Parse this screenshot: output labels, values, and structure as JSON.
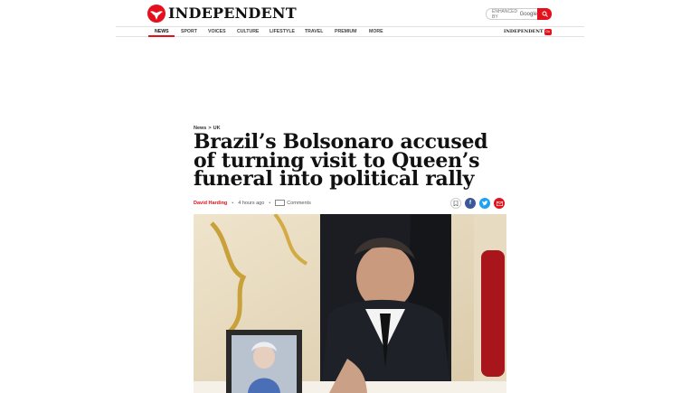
{
  "brand": {
    "name": "INDEPENDENT"
  },
  "search": {
    "placeholder": "ENHANCED BY",
    "provider": "Google"
  },
  "nav": {
    "items": [
      {
        "label": "NEWS",
        "active": true
      },
      {
        "label": "SPORT"
      },
      {
        "label": "VOICES"
      },
      {
        "label": "CULTURE"
      },
      {
        "label": "LIFESTYLE"
      },
      {
        "label": "TRAVEL"
      },
      {
        "label": "PREMIUM"
      },
      {
        "label": "MORE"
      }
    ],
    "premium_word": "INDEPENDENT",
    "premium_badge": "Go"
  },
  "article": {
    "breadcrumb": [
      "News",
      ">",
      "UK"
    ],
    "headline": "Brazil’s Bolsonaro accused of turning visit to Queen’s funeral into political rally",
    "author": "David Harding",
    "time": "4 hours ago",
    "comments_label": "Comments"
  },
  "share": [
    {
      "icon": "bookmark-icon",
      "color": "#ffffff"
    },
    {
      "icon": "facebook-icon",
      "color": "#3b5998"
    },
    {
      "icon": "twitter-icon",
      "color": "#1da1f2"
    },
    {
      "icon": "email-icon",
      "color": "#e4101c"
    }
  ],
  "colors": {
    "accent": "#e4101c"
  }
}
